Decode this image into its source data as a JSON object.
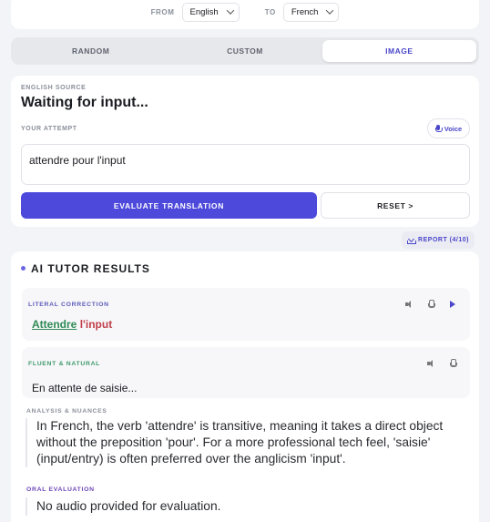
{
  "lang_bar": {
    "from_label": "FROM",
    "from_value": "English",
    "to_label": "TO",
    "to_value": "French"
  },
  "tabs": [
    {
      "label": "RANDOM",
      "active": false
    },
    {
      "label": "CUSTOM",
      "active": false
    },
    {
      "label": "IMAGE",
      "active": true
    }
  ],
  "source": {
    "label": "ENGLISH SOURCE",
    "text": "Waiting for input..."
  },
  "attempt": {
    "label": "YOUR ATTEMPT",
    "voice_label": "Voice",
    "value": "attendre pour l'input"
  },
  "actions": {
    "evaluate_label": "EVALUATE TRANSLATION",
    "reset_label": "RESET >"
  },
  "report": {
    "label": "REPORT (4/10)"
  },
  "results": {
    "title": "AI TUTOR RESULTS",
    "literal": {
      "label": "LITERAL CORRECTION",
      "correct_word": "Attendre",
      "incorrect_word": "l'input"
    },
    "fluent": {
      "label": "FLUENT & NATURAL",
      "text": "En attente de saisie..."
    },
    "analysis": {
      "label": "ANALYSIS & NUANCES",
      "text": "In French, the verb 'attendre' is transitive, meaning it takes a direct object without the preposition 'pour'. For a more professional tech feel, 'saisie' (input/entry) is often preferred over the anglicism 'input'."
    },
    "oral": {
      "label": "ORAL EVALUATION",
      "text": "No audio provided for evaluation."
    }
  },
  "colors": {
    "accent": "#4c49db",
    "correct": "#2f8a55",
    "incorrect": "#c0404a",
    "fluent_label": "#3f9a6b",
    "oral_label": "#6b46b8"
  },
  "icons": [
    "chevron-down-icon",
    "mic-icon",
    "download-icon",
    "speaker-icon",
    "play-icon"
  ]
}
